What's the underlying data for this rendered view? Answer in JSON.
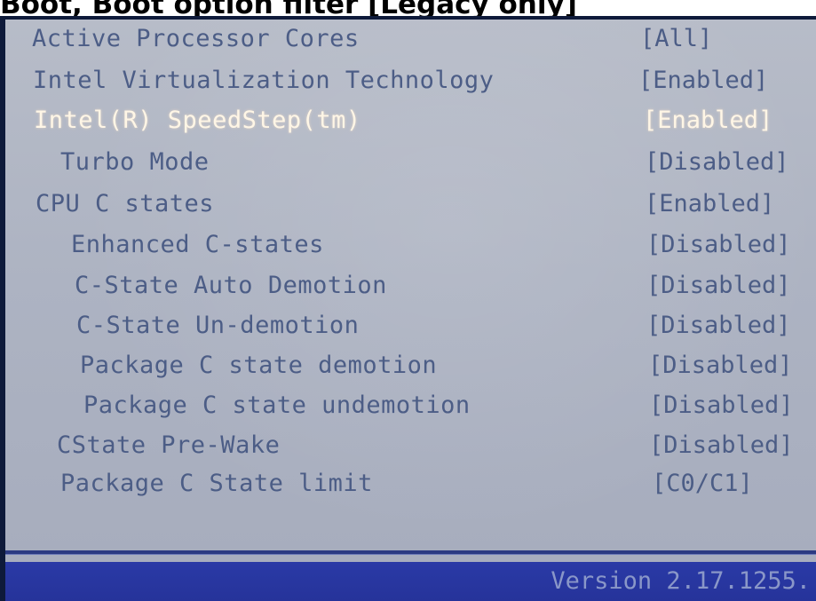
{
  "caption": "Boot, Boot option filter [Legacy only]",
  "bios": {
    "items": [
      {
        "label": "Active Processor Cores",
        "value": "[All]"
      },
      {
        "label": "Intel Virtualization Technology",
        "value": "[Enabled]"
      },
      {
        "label": "Intel(R) SpeedStep(tm)",
        "value": "[Enabled]",
        "selected": true
      },
      {
        "label": "Turbo Mode",
        "value": "[Disabled]"
      },
      {
        "label": "CPU C states",
        "value": "[Enabled]"
      },
      {
        "label": "Enhanced C-states",
        "value": "[Disabled]"
      },
      {
        "label": "C-State Auto Demotion",
        "value": "[Disabled]"
      },
      {
        "label": "C-State Un-demotion",
        "value": "[Disabled]"
      },
      {
        "label": "Package C state demotion",
        "value": "[Disabled]"
      },
      {
        "label": "Package C state undemotion",
        "value": "[Disabled]"
      },
      {
        "label": "CState Pre-Wake",
        "value": "[Disabled]"
      },
      {
        "label": "Package C State limit",
        "value": "[C0/C1]"
      }
    ]
  },
  "footer": {
    "version": "Version 2.17.1255."
  },
  "colors": {
    "screen_background": "#adb3c2",
    "item_text": "#4c5d86",
    "selected_text": "#fff6e6",
    "footer_bar": "#2a3aa6",
    "footer_text": "#8a97c8"
  }
}
